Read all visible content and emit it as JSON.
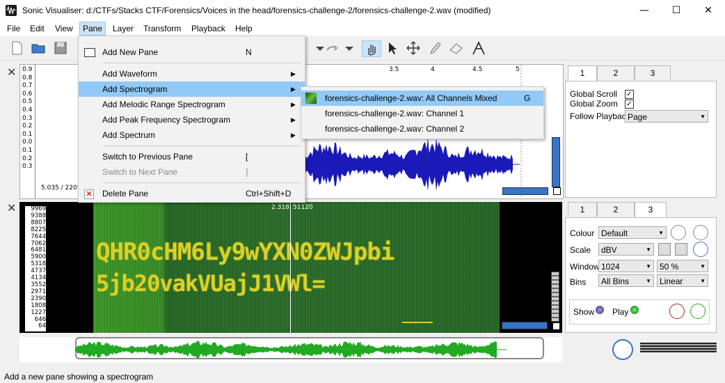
{
  "window": {
    "title": "Sonic Visualiser: d:/CTFs/Stacks CTF/Forensics/Voices in the head/forensics-challenge-2/forensics-challenge-2.wav (modified)",
    "minimize": "—",
    "maximize": "☐",
    "close": "✕"
  },
  "menubar": [
    "File",
    "Edit",
    "View",
    "Pane",
    "Layer",
    "Transform",
    "Playback",
    "Help"
  ],
  "pane_menu": {
    "items": [
      {
        "label": "Add New Pane",
        "shortcut": "N"
      },
      {
        "label": "Add Waveform",
        "arrow": "▶"
      },
      {
        "label": "Add Spectrogram",
        "arrow": "▶"
      },
      {
        "label": "Add Melodic Range Spectrogram",
        "arrow": "▶"
      },
      {
        "label": "Add Peak Frequency Spectrogram",
        "arrow": "▶"
      },
      {
        "label": "Add Spectrum",
        "arrow": "▶"
      },
      {
        "label": "Switch to Previous Pane",
        "shortcut": "["
      },
      {
        "label": "Switch to Next Pane",
        "shortcut": "]"
      },
      {
        "label": "Delete Pane",
        "shortcut": "Ctrl+Shift+D"
      }
    ]
  },
  "spectrogram_submenu": [
    {
      "label": "forensics-challenge-2.wav: All Channels Mixed",
      "shortcut": "G"
    },
    {
      "label": "forensics-challenge-2.wav: Channel 1"
    },
    {
      "label": "forensics-challenge-2.wav: Channel 2"
    }
  ],
  "waveform_pane": {
    "scale": [
      "0.9",
      "0.8",
      "0.7",
      "0.6",
      "0.5",
      "0.4",
      "0.3",
      "0.2",
      "0.1",
      "0.0",
      "0.1",
      "0.2",
      "0.3"
    ],
    "top_ruler": [
      "3.5",
      "4",
      "4.5",
      "5"
    ],
    "position_label": "5.035 / 2205"
  },
  "spectrogram_pane": {
    "freq_scale": [
      "9969",
      "9388",
      "8807",
      "8225",
      "7644",
      "7062",
      "6481",
      "5900",
      "5318",
      "4737",
      "4134",
      "3552",
      "2971",
      "2390",
      "1808",
      "1227",
      "646",
      "64"
    ],
    "cursor_time": "2.318",
    "cursor_frame": "51120",
    "text_line1": "QHR0cHM6Ly9wYXN0ZWJpbi",
    "text_line2": "5jb20vakVUajJ1VWl="
  },
  "panel1": {
    "tabs": [
      "1",
      "2",
      "3"
    ],
    "global_scroll_label": "Global Scroll",
    "global_zoom_label": "Global Zoom",
    "follow_playback_label": "Follow Playback",
    "follow_playback_value": "Page",
    "check": "✓"
  },
  "panel2": {
    "tabs": [
      "1",
      "2",
      "3"
    ],
    "colour_label": "Colour",
    "colour_value": "Default",
    "scale_label": "Scale",
    "scale_value": "dBV",
    "window_label": "Window",
    "window_value": "1024",
    "window_overlap": "50 %",
    "bins_label": "Bins",
    "bins_value": "All Bins",
    "bins_scale": "Linear",
    "show_label": "Show",
    "play_label": "Play"
  },
  "status": "Add a new pane showing a spectrogram",
  "colors": {
    "accent": "#91c9f7",
    "wave": "#1a1ab8",
    "spec_green": "#2e8b2e",
    "overview_wave": "#22aa22"
  }
}
